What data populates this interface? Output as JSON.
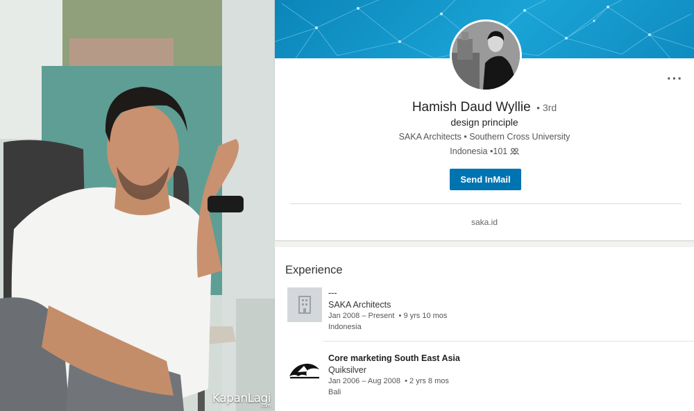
{
  "photo": {
    "watermark": "KapanLagi",
    "watermark_sub": ".com"
  },
  "profile": {
    "name": "Hamish Daud Wyllie",
    "degree": "• 3rd",
    "headline": "design principle",
    "orgs": "SAKA Architects • Southern Cross University",
    "location": "Indonesia",
    "connections": "•101",
    "connections_icon": "people-icon",
    "send_button": "Send InMail",
    "more_icon": "ellipsis-icon",
    "website": "saka.id",
    "accent_color": "#0073b1"
  },
  "experience": {
    "title": "Experience",
    "items": [
      {
        "role": "---",
        "company": "SAKA Architects",
        "dates": "Jan 2008 – Present",
        "duration": "• 9 yrs 10 mos",
        "location": "Indonesia",
        "logo_icon": "building-icon"
      },
      {
        "role": "Core marketing South East Asia",
        "company": "Quiksilver",
        "dates": "Jan 2006 – Aug 2008",
        "duration": "• 2 yrs 8 mos",
        "location": "Bali",
        "logo_icon": "quiksilver-logo-icon"
      }
    ]
  }
}
